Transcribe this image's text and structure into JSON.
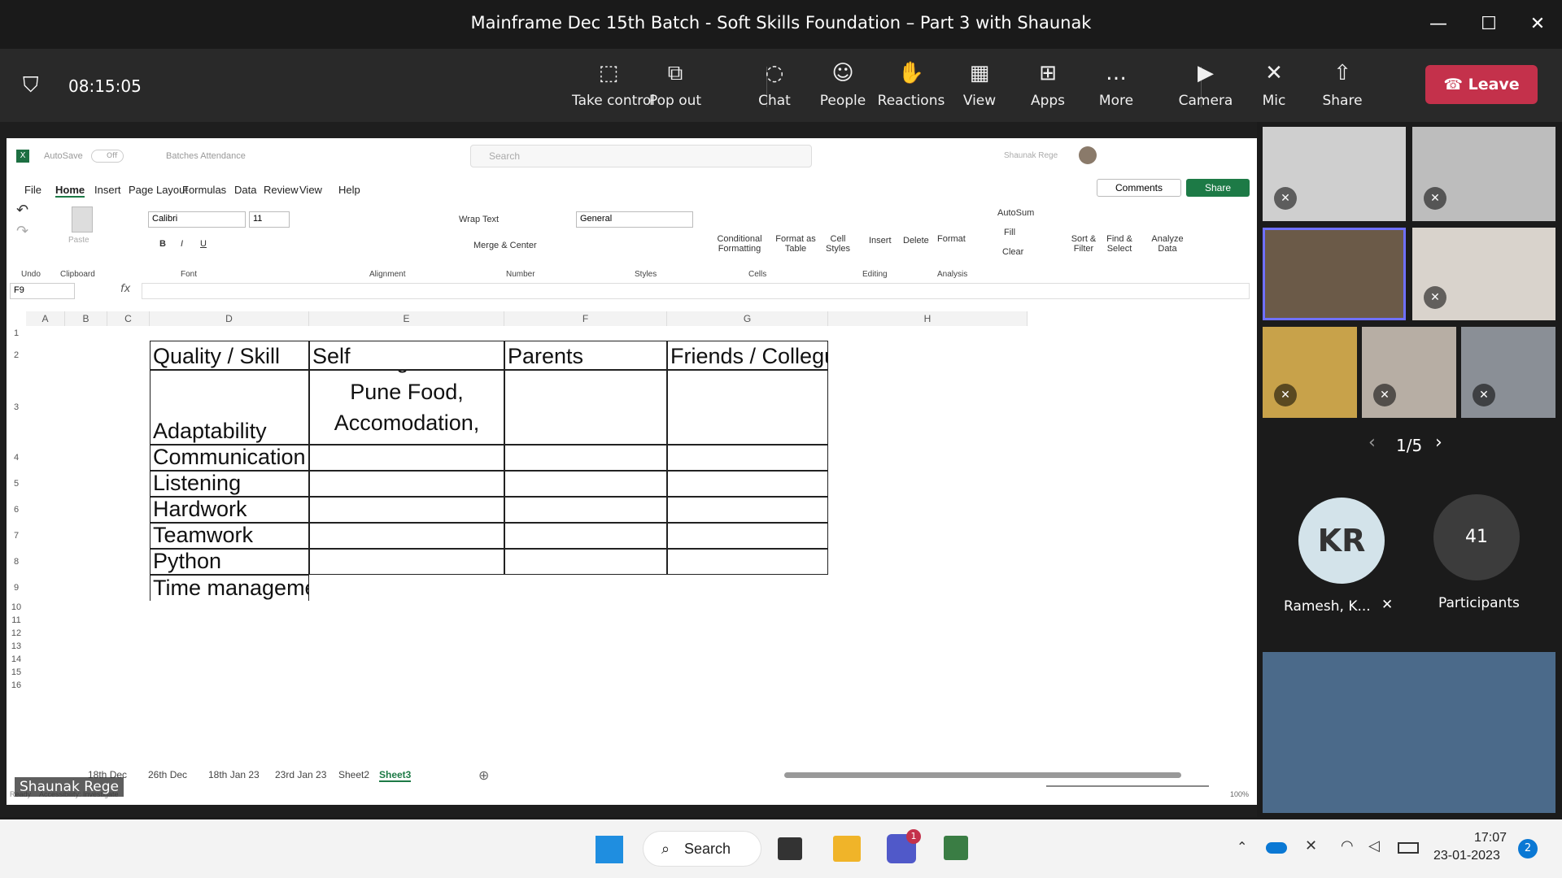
{
  "meeting": {
    "title": "Mainframe Dec 15th Batch - Soft Skills Foundation – Part 3 with  Shaunak",
    "timer": "08:15:05",
    "leave": "Leave"
  },
  "toolbar": [
    {
      "icon": "take-control-icon",
      "label": "Take control"
    },
    {
      "icon": "pop-out-icon",
      "label": "Pop out"
    },
    {
      "icon": "chat-icon",
      "label": "Chat"
    },
    {
      "icon": "people-icon",
      "label": "People"
    },
    {
      "icon": "reactions-icon",
      "label": "Reactions"
    },
    {
      "icon": "view-icon",
      "label": "View"
    },
    {
      "icon": "apps-icon",
      "label": "Apps"
    },
    {
      "icon": "more-icon",
      "label": "More"
    },
    {
      "icon": "camera-icon",
      "label": "Camera"
    },
    {
      "icon": "mic-icon",
      "label": "Mic"
    },
    {
      "icon": "share-icon",
      "label": "Share"
    }
  ],
  "excel": {
    "autosave": "AutoSave",
    "autosave_state": "Off",
    "filename": "Batches Attendance",
    "search": "Search",
    "user": "Shaunak Rege",
    "comments": "Comments",
    "share": "Share",
    "menu": [
      "File",
      "Home",
      "Insert",
      "Page Layout",
      "Formulas",
      "Data",
      "Review",
      "View",
      "Help"
    ],
    "font": "Calibri",
    "size": "11",
    "number_format": "General",
    "name_box": "F9",
    "groups": [
      "Undo",
      "Clipboard",
      "Font",
      "Alignment",
      "Number",
      "Styles",
      "Cells",
      "Editing",
      "Analysis"
    ],
    "ribbon": {
      "wrap": "Wrap Text",
      "merge": "Merge & Center",
      "cond": "Conditional Formatting",
      "fmt_table": "Format as Table",
      "cell_styles": "Cell Styles",
      "insert": "Insert",
      "delete": "Delete",
      "format": "Format",
      "autosum": "AutoSum",
      "fill": "Fill",
      "clear": "Clear",
      "sort": "Sort & Filter",
      "find": "Find & Select",
      "analyze": "Analyze Data",
      "paste": "Paste"
    },
    "columns": [
      "A",
      "B",
      "C",
      "D",
      "E",
      "F",
      "G",
      "H"
    ],
    "rows": [
      "1",
      "2",
      "3",
      "4",
      "5",
      "6",
      "7",
      "8",
      "9",
      "10",
      "11",
      "12",
      "13",
      "14",
      "15",
      "16"
    ],
    "headers": [
      "Quality / Skill",
      "Self",
      "Parents",
      "Friends / Collegues"
    ],
    "skills": [
      "Adaptability",
      "Communication",
      "Listening",
      "Hardwork",
      "Teamwork",
      "Python",
      "Time management"
    ],
    "self_adapt": "Telangana to Pune Food, Accomodation, Travel",
    "tabs": [
      "18th Dec",
      "26th Dec",
      "18th Jan 23",
      "23rd Jan 23",
      "Sheet2",
      "Sheet3"
    ],
    "status": "Ready",
    "zoom": "100%",
    "accessibility": "Accessibility: Investigate"
  },
  "presenter_label": "Shaunak Rege",
  "gallery": {
    "page": "1/5",
    "avatar_initials": "KR",
    "avatar_name": "Ramesh, K...",
    "participants_count": "41",
    "participants_label": "Participants"
  },
  "taskbar": {
    "search": "Search",
    "time": "17:07",
    "date": "23-01-2023",
    "badge": "2",
    "teams_badge": "1"
  }
}
